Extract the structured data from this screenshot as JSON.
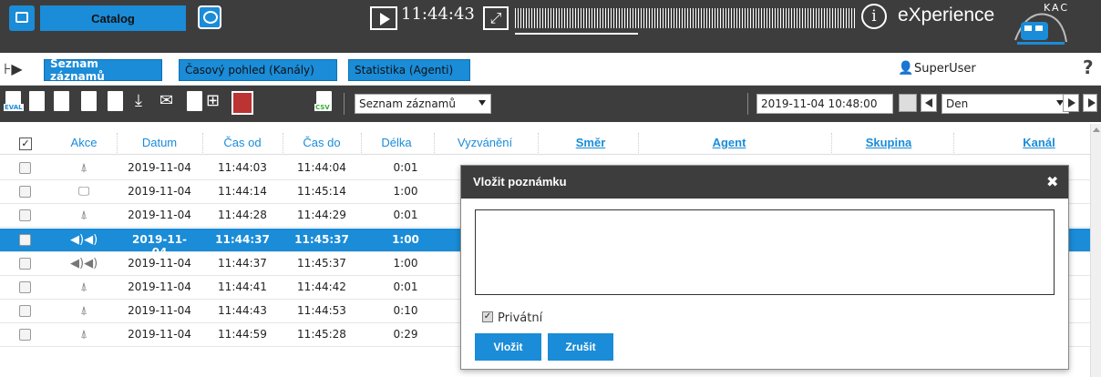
{
  "topbar": {
    "catalog_label": "Catalog",
    "clock": "11:44:43",
    "brand": "eXperience",
    "logo_text": "KAC",
    "colors": {
      "bar": "#3d3d3d",
      "accent": "#1a8cd8"
    }
  },
  "tabs": [
    {
      "label": "Seznam záznamů",
      "active": true
    },
    {
      "label": "Časový pohled (Kanály)",
      "active": false
    },
    {
      "label": "Statistika (Agenti)",
      "active": false
    }
  ],
  "user": {
    "name": "SuperUser"
  },
  "toolbar": {
    "eval_badge": "EVAL",
    "csv_badge": "CSV",
    "view_select": "Seznam záznamů",
    "datetime": "2019-11-04 10:48:00",
    "period_select": "Den"
  },
  "table": {
    "headers": {
      "akce": "Akce",
      "datum": "Datum",
      "cas_od": "Čas od",
      "cas_do": "Čas do",
      "delka": "Délka",
      "vyzvaneni": "Vyzvánění",
      "smer": "Směr",
      "agent": "Agent",
      "skupina": "Skupina",
      "kanal": "Kanál"
    },
    "rows": [
      {
        "icon": "antenna-icon",
        "glyph": "⍋",
        "datum": "2019-11-04",
        "od": "11:44:03",
        "do": "11:44:04",
        "delka": "0:01",
        "selected": false
      },
      {
        "icon": "monitor-icon",
        "glyph": "🖵",
        "datum": "2019-11-04",
        "od": "11:44:14",
        "do": "11:45:14",
        "delka": "1:00",
        "selected": false
      },
      {
        "icon": "antenna-icon",
        "glyph": "⍋",
        "datum": "2019-11-04",
        "od": "11:44:28",
        "do": "11:44:29",
        "delka": "0:01",
        "selected": false
      },
      {
        "icon": "speakers-icon",
        "glyph": "◀)◀)",
        "datum": "2019-11-04",
        "od": "11:44:37",
        "do": "11:45:37",
        "delka": "1:00",
        "selected": true
      },
      {
        "icon": "speakers-icon",
        "glyph": "◀)◀)",
        "datum": "2019-11-04",
        "od": "11:44:37",
        "do": "11:45:37",
        "delka": "1:00",
        "selected": false
      },
      {
        "icon": "antenna-icon",
        "glyph": "⍋",
        "datum": "2019-11-04",
        "od": "11:44:41",
        "do": "11:44:42",
        "delka": "0:01",
        "selected": false
      },
      {
        "icon": "antenna-icon",
        "glyph": "⍋",
        "datum": "2019-11-04",
        "od": "11:44:43",
        "do": "11:44:53",
        "delka": "0:10",
        "selected": false
      },
      {
        "icon": "antenna-icon",
        "glyph": "⍋",
        "datum": "2019-11-04",
        "od": "11:44:59",
        "do": "11:45:28",
        "delka": "0:29",
        "selected": false
      }
    ]
  },
  "dialog": {
    "title": "Vložit poznámku",
    "close": "✖",
    "checkbox_label": "Privátní",
    "checkbox_checked": true,
    "submit_label": "Vložit",
    "cancel_label": "Zrušit"
  }
}
